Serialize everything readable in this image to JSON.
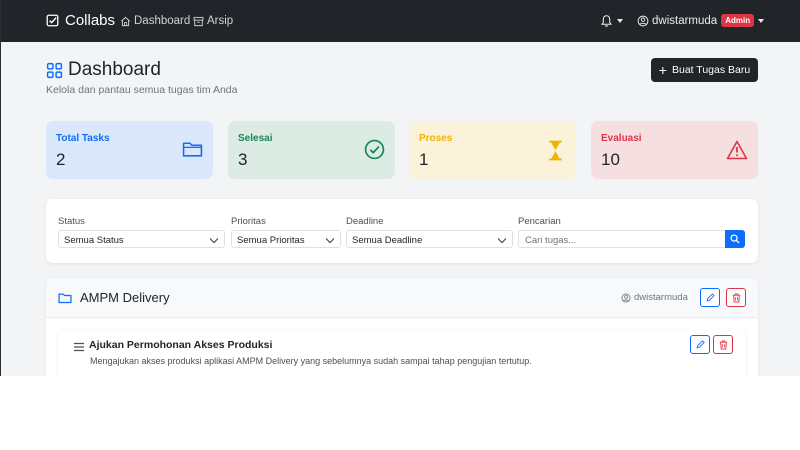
{
  "navbar": {
    "brand": "Collabs",
    "links": [
      {
        "label": "Dashboard",
        "icon": "home-icon"
      },
      {
        "label": "Arsip",
        "icon": "archive-icon"
      }
    ],
    "notifications_icon": "bell-icon",
    "user": {
      "name": "dwistarmuda",
      "role_badge": "Admin",
      "icon": "user-circle-icon"
    }
  },
  "header": {
    "title": "Dashboard",
    "subtitle": "Kelola dan pantau semua tugas tim Anda",
    "new_task_button": "Buat Tugas Baru"
  },
  "stats": [
    {
      "label": "Total Tasks",
      "value": "2",
      "icon": "folder-icon",
      "color": "#0d6efd",
      "bg": "#dbe7fb"
    },
    {
      "label": "Selesai",
      "value": "3",
      "icon": "check-circle-icon",
      "color": "#198754",
      "bg": "#dcebe3"
    },
    {
      "label": "Proses",
      "value": "1",
      "icon": "hourglass-icon",
      "color": "#f0b400",
      "bg": "#fbf3d9"
    },
    {
      "label": "Evaluasi",
      "value": "10",
      "icon": "warning-icon",
      "color": "#dc3545",
      "bg": "#f6dfe1"
    }
  ],
  "filters": {
    "status": {
      "label": "Status",
      "value": "Semua Status"
    },
    "priority": {
      "label": "Prioritas",
      "value": "Semua Prioritas"
    },
    "deadline": {
      "label": "Deadline",
      "value": "Semua Deadline"
    },
    "search": {
      "label": "Pencarian",
      "placeholder": "Cari tugas..."
    }
  },
  "project": {
    "name": "AMPM Delivery",
    "owner": "dwistarmuda",
    "tasks": [
      {
        "title": "Ajukan Permohonan Akses Produksi",
        "description": "Mengajukan akses produksi aplikasi AMPM Delivery yang sebelumnya sudah sampai tahap pengujian tertutup."
      }
    ]
  }
}
